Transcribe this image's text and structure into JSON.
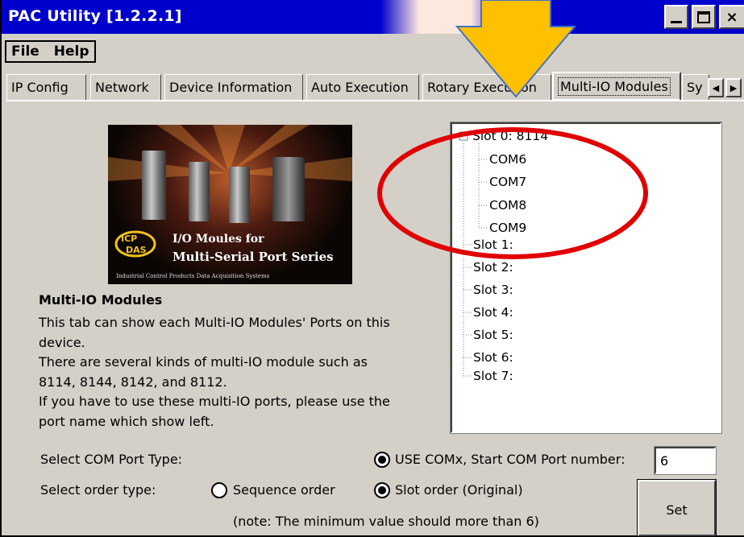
{
  "window": {
    "title": "PAC Utility  [1.2.2.1]",
    "controls": [
      "minimize-icon",
      "maximize-icon",
      "close-icon"
    ]
  },
  "menu": {
    "items": [
      "File",
      "Help"
    ]
  },
  "tabs": [
    {
      "label": "IP Config"
    },
    {
      "label": "Network"
    },
    {
      "label": "Device Information"
    },
    {
      "label": "Auto Execution"
    },
    {
      "label": "Rotary Execution"
    },
    {
      "label": "Multi-IO Modules",
      "active": true
    },
    {
      "label": "Sy"
    }
  ],
  "image": {
    "line1": "I/O Moules for",
    "line2": "Multi-Serial Port Series",
    "footer": "Industrial Control Products Data Acquisition Systems"
  },
  "description": {
    "title": "Multi-IO Modules",
    "lines": [
      "This tab can show each Multi-IO Modules' Ports on this",
      "device.",
      "There are several kinds of multi-IO module such as",
      "8114, 8144, 8142, and 8112.",
      "If you have to use these multi-IO ports, please use the",
      "port name which show left."
    ]
  },
  "tree": {
    "expander": "−",
    "slot0": {
      "label": "Slot 0: 8114",
      "children": [
        "COM6",
        "COM7",
        "COM8",
        "COM9"
      ]
    },
    "slots": [
      "Slot 1:",
      "Slot 2:",
      "Slot 3:",
      "Slot 4:",
      "Slot 5:",
      "Slot 6:",
      "Slot 7:"
    ]
  },
  "settings": {
    "com_port_type_label": "Select COM Port Type:",
    "use_comx_label": "USE COMx, Start COM Port number:",
    "start_com_value": "6",
    "order_type_label": "Select order type:",
    "sequence_label": "Sequence order",
    "slot_label": "Slot order (Original)",
    "note": "(note: The minimum value should more than 6)",
    "set_label": "Set"
  },
  "annotations": {
    "arrow_color": "#ffc000",
    "ellipse_color": "#e00000"
  }
}
